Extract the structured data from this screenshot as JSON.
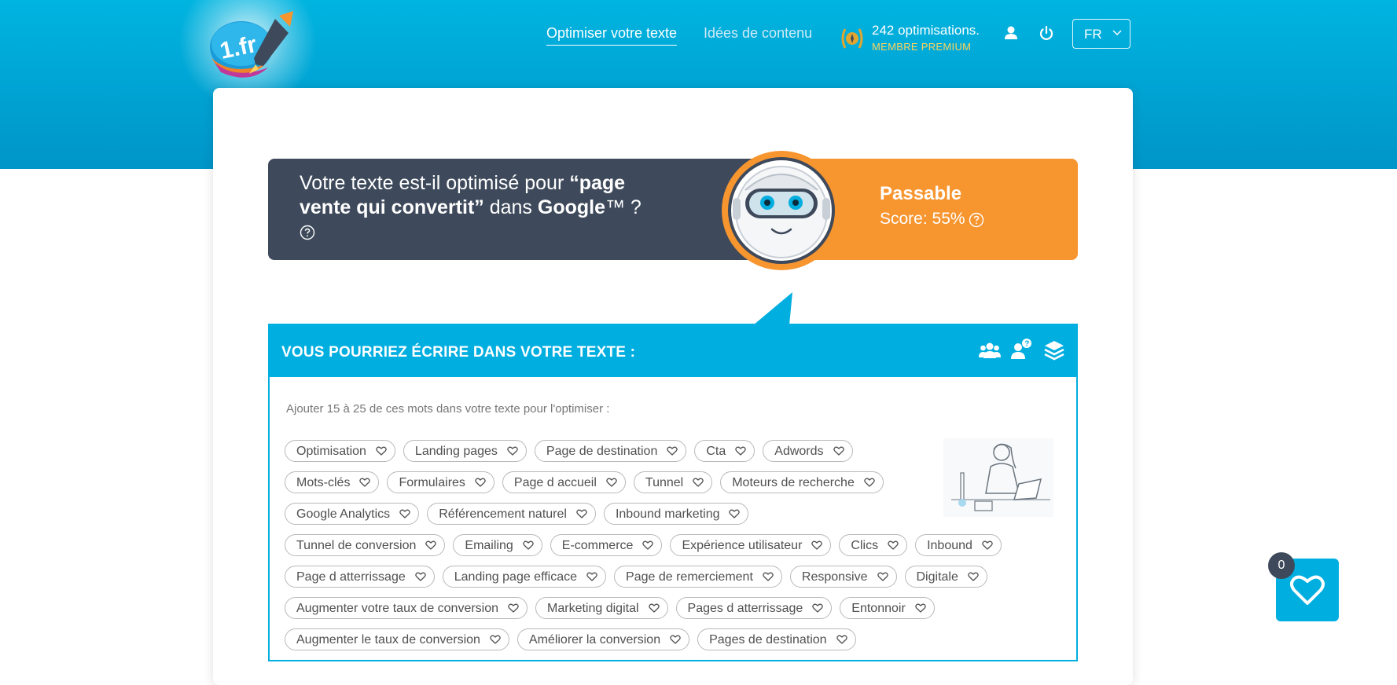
{
  "header": {
    "nav": [
      {
        "label": "Optimiser votre texte",
        "active": true
      },
      {
        "label": "Idées de contenu",
        "active": false
      }
    ],
    "premium": {
      "count": "242 optimisations.",
      "label": "MEMBRE PREMIUM"
    },
    "language": "FR",
    "logo_text": "1.fr"
  },
  "score": {
    "question_prefix": "Votre texte est-il optimisé pour ",
    "keyword": "“page vente qui convertit”",
    "question_mid": " dans ",
    "engine": "Google",
    "question_suffix": "™ ?",
    "verdict": "Passable",
    "score_text": "Score: 55%",
    "value": 55
  },
  "keywords": {
    "title": "VOUS POURRIEZ ÉCRIRE DANS VOTRE TEXTE :",
    "instruction": "Ajouter 15 à 25 de ces mots dans votre texte pour l'optimiser :",
    "rows": [
      [
        "Optimisation",
        "Landing pages",
        "Page de destination",
        "Cta",
        "Adwords"
      ],
      [
        "Mots-clés",
        "Formulaires",
        "Page d accueil",
        "Tunnel",
        "Moteurs de recherche"
      ],
      [
        "Google Analytics",
        "Référencement naturel",
        "Inbound marketing"
      ],
      [
        "Tunnel de conversion",
        "Emailing",
        "E-commerce",
        "Expérience utilisateur",
        "Clics",
        "Inbound"
      ],
      [
        "Page d atterrissage",
        "Landing page efficace",
        "Page de remerciement",
        "Responsive",
        "Digitale"
      ],
      [
        "Augmenter votre taux de conversion",
        "Marketing digital",
        "Pages d atterrissage",
        "Entonnoir"
      ],
      [
        "Augmenter le taux de conversion",
        "Améliorer la conversion",
        "Pages de destination"
      ]
    ]
  },
  "favorites": {
    "count": "0"
  },
  "colors": {
    "brand_blue": "#00aee0",
    "dark_panel": "#3e4a5b",
    "orange": "#f7952f",
    "premium_gold": "#ffd35c"
  },
  "icons": {
    "premium": "laurel-badge-icon",
    "user": "user-icon",
    "power": "power-icon",
    "chevron": "chevron-down-icon",
    "help": "question-circle-icon",
    "tool1": "users-group-icon",
    "tool2": "user-question-icon",
    "tool3": "layers-icon",
    "tag": "heart-outline-icon",
    "fav": "heart-icon"
  }
}
